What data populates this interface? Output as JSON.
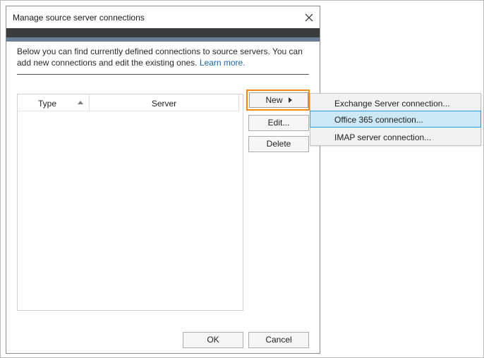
{
  "dialog": {
    "title": "Manage source server connections",
    "description": "Below you can find currently defined connections to source servers. You can add new connections and edit the existing ones.",
    "learn_more": "Learn more."
  },
  "list": {
    "columns": [
      "Type",
      "Server"
    ],
    "rows": []
  },
  "buttons": {
    "new": "New",
    "edit": "Edit...",
    "delete": "Delete",
    "ok": "OK",
    "cancel": "Cancel"
  },
  "new_menu": {
    "items": [
      "Exchange Server connection...",
      "Office 365 connection...",
      "IMAP server connection..."
    ],
    "highlighted_index": 1
  },
  "colors": {
    "highlight_border": "#f0891c",
    "menu_highlight": "#cce8f5",
    "link": "#1a64a8"
  }
}
